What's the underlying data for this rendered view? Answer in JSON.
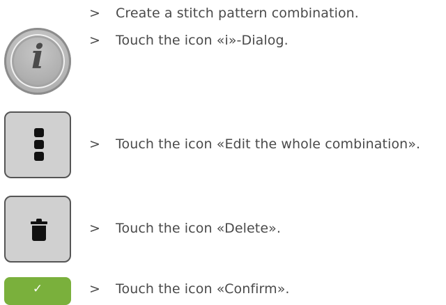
{
  "steps": [
    {
      "marker": ">",
      "text": "Create a stitch pattern combination."
    },
    {
      "marker": ">",
      "text": "Touch the icon «i»-Dialog."
    },
    {
      "marker": ">",
      "text": "Touch the icon «Edit the whole combination»."
    },
    {
      "marker": ">",
      "text": "Touch the icon «Delete»."
    },
    {
      "marker": ">",
      "text": "Touch the icon «Confirm»."
    }
  ],
  "icons": {
    "info": {
      "glyph": "i",
      "icon": "info-icon"
    },
    "edit": {
      "icon": "vertical-ellipsis-icon"
    },
    "delete": {
      "icon": "trash-icon"
    },
    "confirm": {
      "glyph": "✓",
      "icon": "checkmark-icon",
      "color": "#7ab03c"
    }
  }
}
